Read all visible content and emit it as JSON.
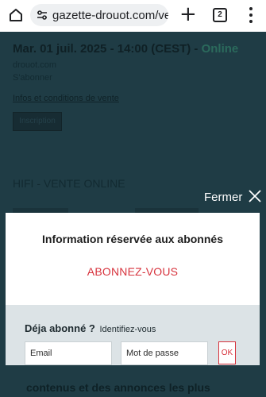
{
  "browser": {
    "url": "gazette-drouot.com/ver",
    "tab_count": "2"
  },
  "background": {
    "date_prefix": "Mar. 01 juil. 2025 - 14:00 (CEST) - ",
    "date_online": "Online",
    "subtitle": "drouot.com",
    "abonner": "S'abonner",
    "infos_link": "Infos et conditions de vente",
    "button_label": "Inscription",
    "hifi_title": "HIFI - VENTE ONLINE",
    "bottom_text": "contenus et des annonces les plus"
  },
  "overlay": {
    "close_label": "Fermer"
  },
  "modal": {
    "title": "Information réservée aux abonnés",
    "subscribe": "ABONNEZ-VOUS",
    "already": "Déja abonné ?",
    "identify": "Identifiez-vous",
    "email_placeholder": "Email",
    "password_placeholder": "Mot de passe",
    "ok_label": "OK"
  },
  "colors": {
    "accent_red": "#d7333d",
    "overlay_teal": "#1f3c45"
  }
}
